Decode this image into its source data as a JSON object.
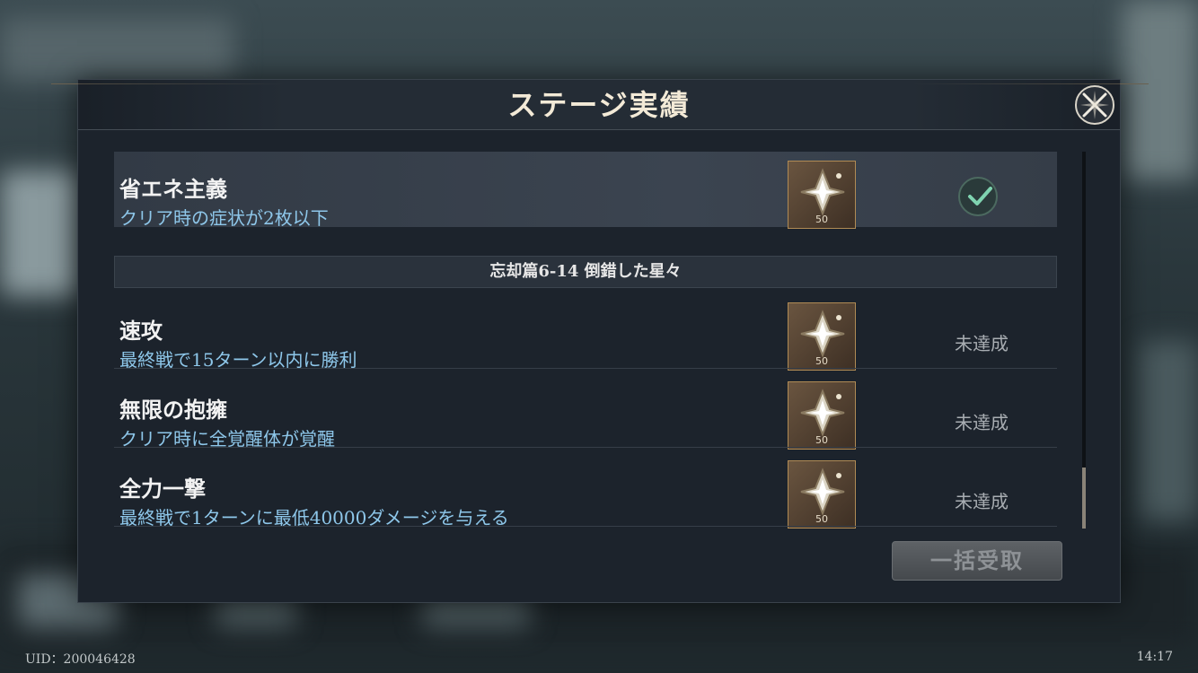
{
  "dialog": {
    "title": "ステージ実績",
    "close_icon": "close-icon"
  },
  "achievements": [
    {
      "title": "省エネ主義",
      "description": "クリア時の症状が2枚以下",
      "reward_count": "50",
      "status": "completed",
      "status_icon": "checkmark-icon"
    }
  ],
  "section": {
    "title": "忘却篇6-14 倒錯した星々"
  },
  "section_achievements": [
    {
      "title": "速攻",
      "description": "最終戦で15ターン以内に勝利",
      "reward_count": "50",
      "status_text": "未達成"
    },
    {
      "title": "無限の抱擁",
      "description": "クリア時に全覚醒体が覚醒",
      "reward_count": "50",
      "status_text": "未達成"
    },
    {
      "title": "全力一撃",
      "description": "最終戦で1ターンに最低40000ダメージを与える",
      "reward_count": "50",
      "status_text": "未達成"
    }
  ],
  "claim_all_label": "一括受取",
  "footer": {
    "uid": "UID：200046428",
    "time": "14:17"
  },
  "colors": {
    "description_text": "#8ec7ea",
    "reward_border": "#b08b55",
    "check_green": "#7fd3b0"
  }
}
